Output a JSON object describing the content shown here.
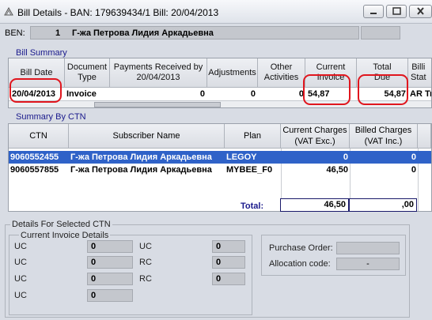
{
  "window": {
    "title": "Bill Details  - BAN: 179639434/1   Bill: 20/04/2013"
  },
  "ben": {
    "label": "BEN:",
    "number": "1",
    "name": "Г-жа Петрова Лидия Аркадьевна"
  },
  "bill_summary": {
    "title": "Bill Summary",
    "headers": [
      "Bill Date",
      "Document\nType",
      "Payments Received by\n20/04/2013",
      "Adjustments",
      "Other\nActivities",
      "Current\nInvoice",
      "Total\nDue",
      "Billi\nStat"
    ],
    "row": {
      "bill_date": "20/04/2013",
      "document_type": "Invoice",
      "payments": "0",
      "adjustments": "0",
      "other_activities": "0",
      "current_invoice": "54,87",
      "total_due": "54,87",
      "status": "AR Tra"
    }
  },
  "summary_by_ctn": {
    "title": "Summary By CTN",
    "headers": [
      "CTN",
      "Subscriber Name",
      "Plan",
      "Current Charges\n(VAT Exc.)",
      "Billed Charges\n(VAT Inc.)"
    ],
    "rows": [
      {
        "ctn": "9060552455",
        "name": "Г-жа Петрова Лидия Аркадьевна",
        "plan": "LEGOY",
        "current": "0",
        "billed": "0"
      },
      {
        "ctn": "9060557855",
        "name": "Г-жа Петрова Лидия Аркадьевна",
        "plan": "MYBEE_F0",
        "current": "46,50",
        "billed": "0"
      }
    ],
    "total_label": "Total:",
    "total_current": "46,50",
    "total_billed": ",00"
  },
  "details": {
    "title": "Details For Selected CTN",
    "current_invoice_title": "Current Invoice Details",
    "left_labels": [
      "UC",
      "UC",
      "UC",
      "UC"
    ],
    "left_values": [
      "0",
      "0",
      "0",
      "0"
    ],
    "right_labels": [
      "UC",
      "RC",
      "RC"
    ],
    "right_values": [
      "0",
      "0",
      "0"
    ],
    "purchase_order_label": "Purchase Order:",
    "purchase_order_value": "",
    "allocation_code_label": "Allocation code:",
    "allocation_code_value": "-"
  },
  "colors": {
    "selection": "#2f62c8",
    "highlight_oval": "#e0161e",
    "section_title": "#1a1a8c"
  },
  "icons": [
    "app-icon",
    "minimize-icon",
    "maximize-icon",
    "close-icon"
  ]
}
